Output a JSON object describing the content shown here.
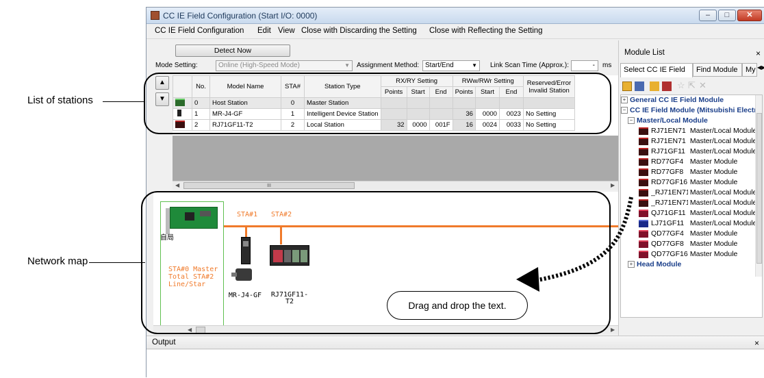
{
  "callouts": {
    "list_of_stations": "List of stations",
    "network_map": "Network map",
    "drag_drop_note": "Drag and drop the text."
  },
  "window": {
    "title": "CC IE Field Configuration (Start I/O: 0000)",
    "min_symbol": "–",
    "max_symbol": "□",
    "close_symbol": "✕"
  },
  "menu": [
    "CC IE Field Configuration",
    "Edit",
    "View",
    "Close with Discarding the Setting",
    "Close with Reflecting the Setting"
  ],
  "toolbar": {
    "detect_now": "Detect Now",
    "mode_setting_label": "Mode Setting:",
    "mode_setting_value": "Online (High-Speed Mode)",
    "assignment_method_label": "Assignment Method:",
    "assignment_method_value": "Start/End",
    "link_scan_label": "Link Scan Time (Approx.):",
    "link_scan_value": "-",
    "link_scan_unit": "ms"
  },
  "station_table": {
    "headers": {
      "no": "No.",
      "model": "Model Name",
      "sta": "STA#",
      "type": "Station Type",
      "rxry": "RX/RY Setting",
      "rwwrwr": "RWw/RWr Setting",
      "reserved": "Reserved/Error Invalid Station",
      "points": "Points",
      "start": "Start",
      "end": "End"
    },
    "rows": [
      {
        "no": "0",
        "model": "Host Station",
        "sta": "0",
        "type": "Master Station",
        "rx_points": "",
        "rx_start": "",
        "rx_end": "",
        "rw_points": "",
        "rw_start": "",
        "rw_end": "",
        "reserved": ""
      },
      {
        "no": "1",
        "model": "MR-J4-GF",
        "sta": "1",
        "type": "Intelligent Device Station",
        "rx_points": "",
        "rx_start": "",
        "rx_end": "",
        "rw_points": "36",
        "rw_start": "0000",
        "rw_end": "0023",
        "reserved": "No Setting"
      },
      {
        "no": "2",
        "model": "RJ71GF11-T2",
        "sta": "2",
        "type": "Local Station",
        "rx_points": "32",
        "rx_start": "0000",
        "rx_end": "001F",
        "rw_points": "16",
        "rw_start": "0024",
        "rw_end": "0033",
        "reserved": "No Setting"
      }
    ],
    "scroll_thumb_text": "III"
  },
  "network_map": {
    "host_label": "自局",
    "sta_labels": [
      "STA#1",
      "STA#2"
    ],
    "master_info": [
      "STA#0  Master",
      "Total STA#2",
      "Line/Star"
    ],
    "devices": [
      "MR-J4-GF",
      "RJ71GF11-\nT2"
    ]
  },
  "module_list": {
    "title": "Module List",
    "tabs": [
      "Select CC IE Field",
      "Find Module",
      "My"
    ],
    "tree": [
      {
        "kind": "cat",
        "expander": "+",
        "label": "General CC IE Field Module"
      },
      {
        "kind": "cat",
        "expander": "−",
        "label": "CC IE Field Module (Mitsubishi Electric)"
      },
      {
        "kind": "subcat",
        "expander": "−",
        "label": "Master/Local Module"
      },
      {
        "kind": "item",
        "icon": "plc",
        "model": "RJ71EN71",
        "desc": "Master/Local Module"
      },
      {
        "kind": "item",
        "icon": "plc",
        "model": "RJ71EN71",
        "desc": "Master/Local Module"
      },
      {
        "kind": "item",
        "icon": "plc",
        "model": "RJ71GF11",
        "desc": "Master/Local Module"
      },
      {
        "kind": "item",
        "icon": "plc",
        "model": "RD77GF4",
        "desc": "Master Module"
      },
      {
        "kind": "item",
        "icon": "plc",
        "model": "RD77GF8",
        "desc": "Master Module"
      },
      {
        "kind": "item",
        "icon": "plc",
        "model": "RD77GF16",
        "desc": "Master Module"
      },
      {
        "kind": "item",
        "icon": "plc",
        "model": "_RJ71EN71",
        "desc": "Master/Local Module"
      },
      {
        "kind": "item",
        "icon": "plc",
        "model": "_RJ71EN71",
        "desc": "Master/Local Module"
      },
      {
        "kind": "item",
        "icon": "q",
        "model": "QJ71GF11",
        "desc": "Master/Local Module"
      },
      {
        "kind": "item",
        "icon": "lj",
        "model": "LJ71GF11",
        "desc": "Master/Local Module"
      },
      {
        "kind": "item",
        "icon": "q",
        "model": "QD77GF4",
        "desc": "Master Module"
      },
      {
        "kind": "item",
        "icon": "q",
        "model": "QD77GF8",
        "desc": "Master Module"
      },
      {
        "kind": "item",
        "icon": "q",
        "model": "QD77GF16",
        "desc": "Master Module"
      },
      {
        "kind": "cat",
        "expander": "+",
        "label": "Head Module"
      }
    ]
  },
  "output": {
    "title": "Output",
    "close": "×"
  },
  "colors": {
    "accent_orange": "#f07a2a",
    "title_blue": "#1e395b",
    "tree_blue": "#1b3f8a"
  }
}
